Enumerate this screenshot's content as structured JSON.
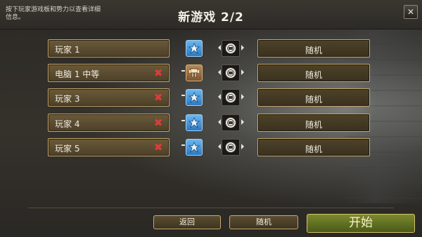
{
  "header": {
    "hint": "按下玩家游戏板和势力以查看详细信息。",
    "title": "新游戏 2/2",
    "close_label": "✕"
  },
  "players": [
    {
      "name": "玩家 1",
      "removable": false,
      "faction": "player",
      "random_label": "随机"
    },
    {
      "name": "电脑 1 中等",
      "removable": true,
      "faction": "ai",
      "random_label": "随机"
    },
    {
      "name": "玩家 3",
      "removable": true,
      "faction": "player",
      "random_label": "随机"
    },
    {
      "name": "玩家 4",
      "removable": true,
      "faction": "player",
      "random_label": "随机"
    },
    {
      "name": "玩家 5",
      "removable": true,
      "faction": "player",
      "random_label": "随机"
    }
  ],
  "remove_glyph": "✖",
  "footer": {
    "back_label": "返回",
    "random_label": "随机",
    "start_label": "开始"
  },
  "colors": {
    "player_faction": "#3a8fd8",
    "ai_faction": "#9a6c3c",
    "remove": "#e03a3a",
    "field_border": "#c8a86a",
    "start_button": "#5f7022"
  },
  "icons": {
    "player_faction": "blue-ship-icon",
    "ai_faction": "brown-mech-icon",
    "team": "board-token-icon"
  }
}
